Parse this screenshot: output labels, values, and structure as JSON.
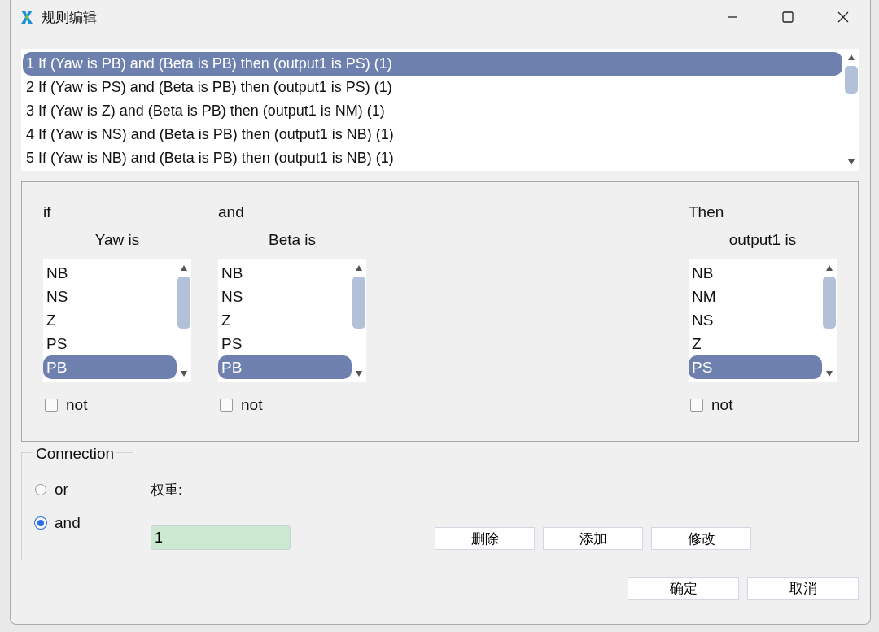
{
  "window": {
    "title": "规则编辑"
  },
  "rules": [
    {
      "text": "1 If (Yaw is PB) and (Beta is PB) then (output1 is PS) (1)",
      "selected": true
    },
    {
      "text": "2 If (Yaw is PS) and (Beta is PB) then (output1 is PS) (1)",
      "selected": false
    },
    {
      "text": "3 If (Yaw is Z) and (Beta is PB) then (output1 is NM) (1)",
      "selected": false
    },
    {
      "text": "4 If (Yaw is NS) and (Beta is PB) then (output1 is NB) (1)",
      "selected": false
    },
    {
      "text": "5 If (Yaw is NB) and (Beta is PB) then (output1 is NB) (1)",
      "selected": false
    }
  ],
  "columns": [
    {
      "keyword": "if",
      "label": "Yaw is",
      "items": [
        {
          "text": "NB",
          "selected": false
        },
        {
          "text": "NS",
          "selected": false
        },
        {
          "text": "Z",
          "selected": false
        },
        {
          "text": "PS",
          "selected": false
        },
        {
          "text": "PB",
          "selected": true
        }
      ],
      "not_label": "not",
      "not_checked": false
    },
    {
      "keyword": "and",
      "label": "Beta is",
      "items": [
        {
          "text": "NB",
          "selected": false
        },
        {
          "text": "NS",
          "selected": false
        },
        {
          "text": "Z",
          "selected": false
        },
        {
          "text": "PS",
          "selected": false
        },
        {
          "text": "PB",
          "selected": true
        }
      ],
      "not_label": "not",
      "not_checked": false
    },
    {
      "keyword": "Then",
      "label": "output1 is",
      "items": [
        {
          "text": "NB",
          "selected": false
        },
        {
          "text": "NM",
          "selected": false
        },
        {
          "text": "NS",
          "selected": false
        },
        {
          "text": "Z",
          "selected": false
        },
        {
          "text": "PS",
          "selected": true
        }
      ],
      "not_label": "not",
      "not_checked": false
    }
  ],
  "connection": {
    "legend": "Connection",
    "options": [
      {
        "label": "or",
        "selected": false
      },
      {
        "label": "and",
        "selected": true
      }
    ]
  },
  "weight": {
    "label": "权重:",
    "value": "1"
  },
  "edit_buttons": [
    "删除",
    "添加",
    "修改"
  ],
  "dialog_buttons": [
    "确定",
    "取消"
  ]
}
